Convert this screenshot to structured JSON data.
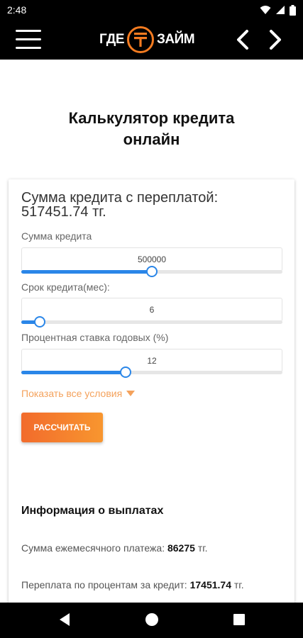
{
  "status": {
    "time": "2:48"
  },
  "header": {
    "logo_left": "ГДЕ",
    "logo_right": "ЗАЙМ"
  },
  "page": {
    "title": "Калькулятор кредита онлайн"
  },
  "calculator": {
    "result_label": "Сумма кредита с переплатой:",
    "result_value": "517451.74 тг.",
    "fields": [
      {
        "label": "Сумма кредита",
        "value": "500000",
        "slider_fraction": 0.5
      },
      {
        "label": "Срок кредита(мес):",
        "value": "6",
        "slider_fraction": 0.07
      },
      {
        "label": "Процентная ставка годовых (%)",
        "value": "12",
        "slider_fraction": 0.4
      }
    ],
    "show_all_label": "Показать все условия",
    "calc_button": "РАССЧИТАТЬ"
  },
  "info": {
    "title": "Информация о выплатах",
    "monthly_label": "Сумма ежемесячного платежа:",
    "monthly_value": "86275",
    "monthly_unit": "тг.",
    "overpay_label": "Переплата по процентам за кредит:",
    "overpay_value": "17451.74",
    "overpay_unit": "тг."
  },
  "colors": {
    "accent": "#f47b20",
    "slider": "#2a86e8",
    "link": "#f4a25c"
  }
}
